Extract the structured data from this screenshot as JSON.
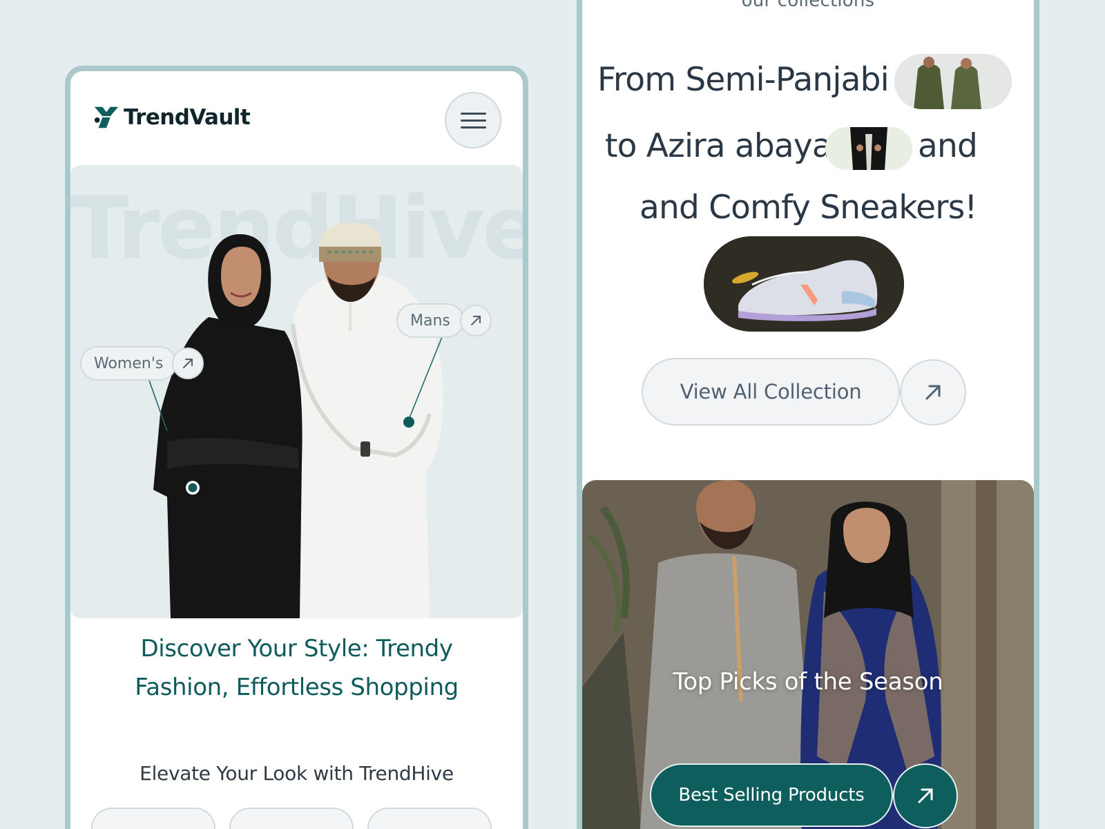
{
  "left_phone": {
    "brand": {
      "name": "TrendVault"
    },
    "hero": {
      "watermark": "TrendHive",
      "tag_women": "Women's",
      "tag_mans": "Mans"
    },
    "headline": "Discover Your Style: Trendy Fashion, Effortless Shopping",
    "headline_line1": "Discover Your Style: Trendy",
    "headline_line2": "Fashion, Effortless Shopping",
    "subheadline": "Elevate Your Look with TrendHive"
  },
  "right_phone": {
    "eyebrow": "our collections",
    "line1": "From Semi-Panjabi",
    "line2": "to Azira abaya",
    "line2_end": "and",
    "line3": "and Comfy Sneakers!",
    "view_all_label": "View All Collection",
    "season_card": {
      "title": "Top Picks of the Season",
      "cta_label": "Best Selling Products"
    }
  },
  "icons": {
    "menu": "hamburger-icon",
    "arrow": "arrow-up-right-icon",
    "logo": "trendvault-logo-mark"
  },
  "colors": {
    "page_bg": "#e6edef",
    "frame": "#a9c9cb",
    "brand_teal": "#0e5e5e",
    "headline_teal": "#0d5b5b",
    "text_dark": "#2a3744"
  }
}
